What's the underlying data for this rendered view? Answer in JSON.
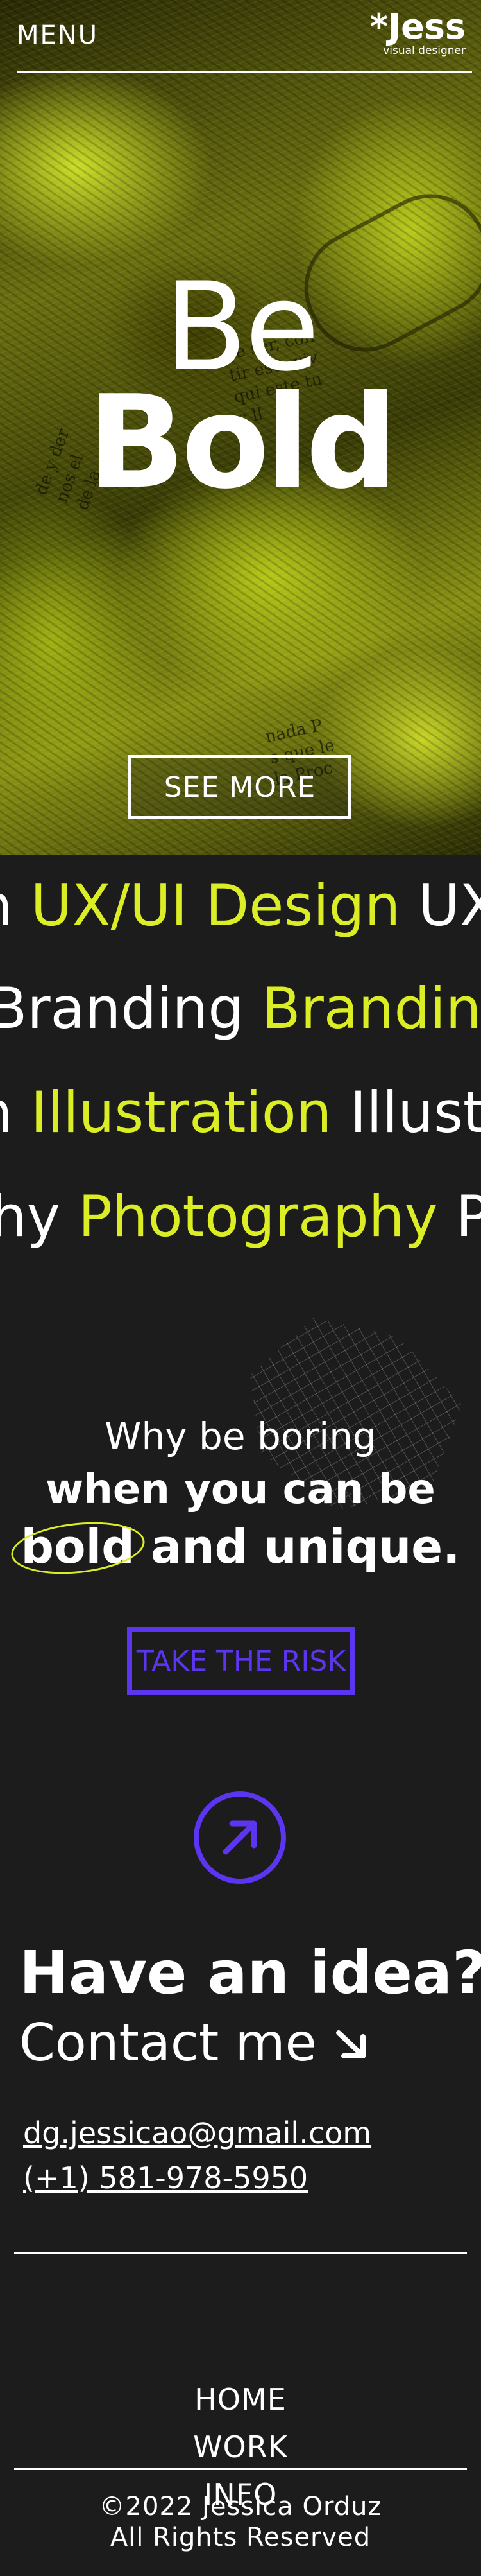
{
  "header": {
    "menu_label": "MENU",
    "logo_text": "*Jess",
    "logo_subtitle": "visual designer"
  },
  "hero": {
    "line1": "Be",
    "line2": "Bold",
    "cta_label": "SEE MORE"
  },
  "services": {
    "rows": [
      [
        "n",
        "UX/UI Design",
        "UX/"
      ],
      [
        "Branding",
        "Branding"
      ],
      [
        "n",
        "Illustration",
        "Illust"
      ],
      [
        "hy",
        "Photography",
        "Ph"
      ]
    ]
  },
  "why": {
    "line1": "Why be boring",
    "line2": "when you can be",
    "line3_highlight": "bold",
    "line3_rest": " and unique.",
    "cta_label": "TAKE THE RISK"
  },
  "contact": {
    "arrow_icon": "arrow-up-right-icon",
    "heading": "Have an idea?",
    "subheading": "Contact me",
    "email": "dg.jessicao@gmail.com",
    "phone": "(+1) 581-978-5950"
  },
  "footer": {
    "nav": [
      "HOME",
      "WORK",
      "INFO"
    ],
    "copyright_line1": "©2022 Jessica Orduz",
    "copyright_line2": "All Rights Reserved"
  },
  "colors": {
    "background": "#1c1c1c",
    "accent_yellow": "#dbee25",
    "accent_purple": "#5b35f0",
    "text": "#ffffff"
  }
}
